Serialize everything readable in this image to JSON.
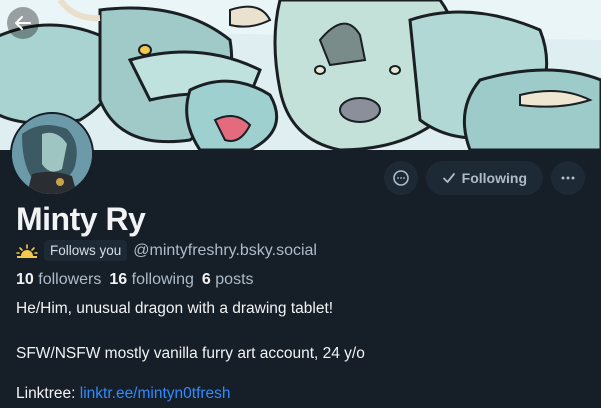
{
  "header": {
    "back_icon": "arrow-left-icon"
  },
  "profile": {
    "display_name": "Minty Ry",
    "follows_you_badge": "Follows you",
    "handle": "@mintyfreshry.bsky.social",
    "stats": {
      "followers_count": "10",
      "followers_label": "followers",
      "following_count": "16",
      "following_label": "following",
      "posts_count": "6",
      "posts_label": "posts"
    },
    "bio": {
      "line1": "He/Him, unusual dragon with a drawing tablet!",
      "line2": "SFW/NSFW mostly vanilla furry art account, 24 y/o",
      "linktree_label": "Linktree:",
      "linktree_url": "linktr.ee/mintyn0tfresh"
    }
  },
  "actions": {
    "message_icon": "chat-bubble-icon",
    "following_label": "Following",
    "following_icon": "checkmark-icon",
    "more_icon": "ellipsis-icon"
  },
  "colors": {
    "background": "#161e27",
    "button_bg": "#1e2936",
    "link": "#2f8bff",
    "muted_text": "#aebbc9"
  }
}
